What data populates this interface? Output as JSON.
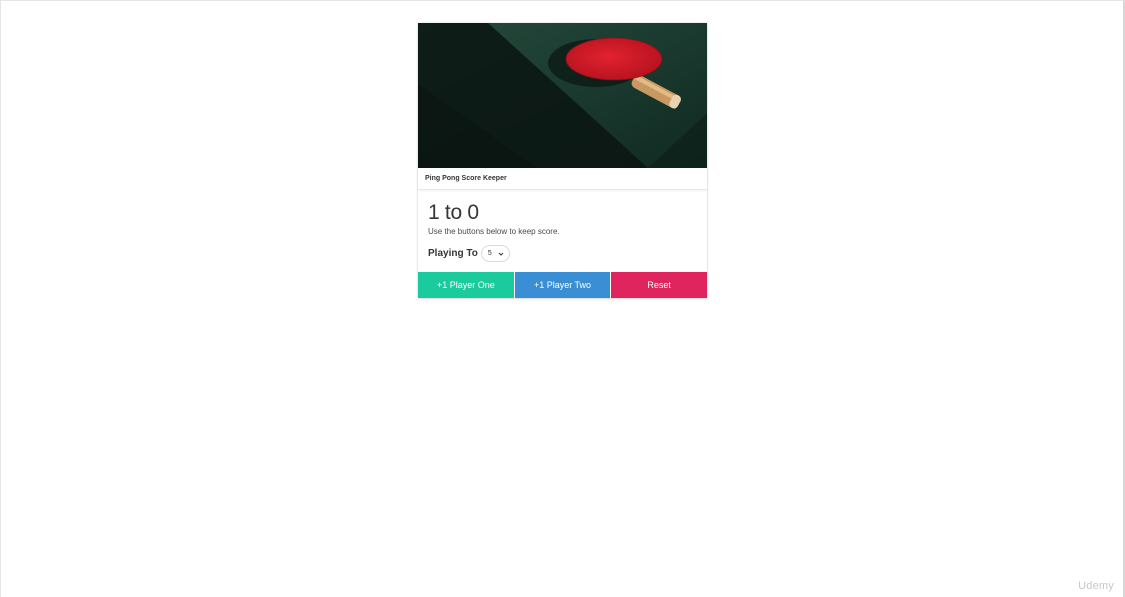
{
  "card": {
    "title": "Ping Pong Score Keeper",
    "image_alt": "ping-pong paddle on table",
    "score": {
      "player_one": 1,
      "player_two": 0,
      "text": "1 to 0"
    },
    "hint": "Use the buttons below to keep score.",
    "playing_to": {
      "label": "Playing To",
      "selected": "5"
    }
  },
  "buttons": {
    "player_one": "+1 Player One",
    "player_two": "+1 Player Two",
    "reset": "Reset"
  },
  "colors": {
    "player_one": "#1ccb9d",
    "player_two": "#3a8fd4",
    "reset": "#e0245e",
    "paddle": "#d4202b",
    "table": "#17342a"
  },
  "watermark": "Udemy"
}
